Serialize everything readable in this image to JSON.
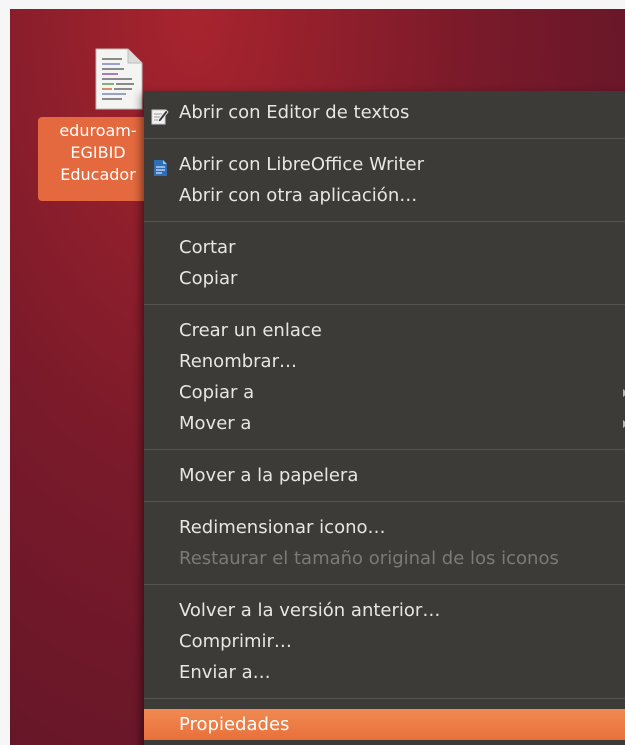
{
  "desktop": {
    "file": {
      "icon": "text-file-icon",
      "label_lines": [
        "eduroam-",
        "EGIBID",
        "Educador"
      ]
    }
  },
  "context_menu": {
    "items": [
      {
        "label": "Abrir con Editor de textos",
        "icon": "text-editor-icon"
      },
      {
        "label": "Abrir con LibreOffice Writer",
        "icon": "libreoffice-writer-icon"
      },
      {
        "label": "Abrir con otra aplicación…"
      },
      {
        "label": "Cortar"
      },
      {
        "label": "Copiar"
      },
      {
        "label": "Crear un enlace"
      },
      {
        "label": "Renombrar…"
      },
      {
        "label": "Copiar a",
        "submenu": true
      },
      {
        "label": "Mover a",
        "submenu": true
      },
      {
        "label": "Mover a la papelera"
      },
      {
        "label": "Redimensionar icono…"
      },
      {
        "label": "Restaurar el tamaño original de los iconos",
        "disabled": true
      },
      {
        "label": "Volver a la versión anterior…"
      },
      {
        "label": "Comprimir…"
      },
      {
        "label": "Enviar a…"
      },
      {
        "label": "Propiedades",
        "highlighted": true
      }
    ]
  },
  "colors": {
    "desktop_background": "#7a1a2a",
    "menu_background": "#3c3b37",
    "menu_text": "#e6e6e4",
    "disabled_text": "#7b7a76",
    "highlight": "#e9703b",
    "selected_label": "#e5693e"
  }
}
